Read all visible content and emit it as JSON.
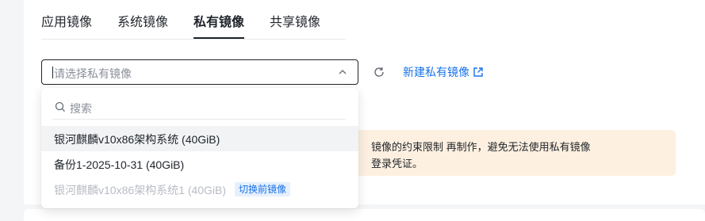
{
  "tabs": [
    {
      "label": "应用镜像"
    },
    {
      "label": "系统镜像"
    },
    {
      "label": "私有镜像"
    },
    {
      "label": "共享镜像"
    }
  ],
  "select": {
    "placeholder": "请选择私有镜像"
  },
  "new_link": {
    "label": "新建私有镜像"
  },
  "alert": {
    "line1": "镜像的约束限制 再制作，避免无法使用私有镜像",
    "line2": "登录凭证。"
  },
  "dropdown": {
    "search_placeholder": "搜索",
    "options": [
      {
        "label": "银河麒麟v10x86架构系统 (40GiB)"
      },
      {
        "label": "备份1-2025-10-31 (40GiB)"
      },
      {
        "label": "银河麒麟v10x86架构系统1 (40GiB)",
        "badge": "切换前镜像"
      }
    ]
  },
  "colors": {
    "accent": "#1a73e8",
    "alert_bg": "#fdf0e0",
    "disabled_text": "#b8bcc4"
  }
}
